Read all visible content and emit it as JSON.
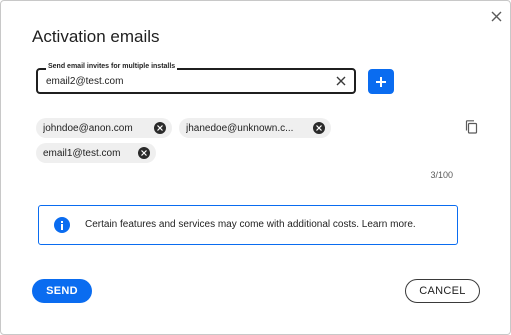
{
  "dialog": {
    "title": "Activation emails",
    "close_icon": "close-icon"
  },
  "email_field": {
    "label": "Send email invites for multiple installs",
    "value": "email2@test.com",
    "placeholder": "",
    "clear_icon": "clear-x-icon"
  },
  "add_button": {
    "icon": "plus-icon"
  },
  "chips": [
    {
      "label": "johndoe@anon.com"
    },
    {
      "label": "jhanedoe@unknown.c..."
    },
    {
      "label": "email1@test.com"
    }
  ],
  "copy_button": {
    "icon": "copy-icon"
  },
  "counter": "3/100",
  "info": {
    "icon": "info-icon",
    "text": "Certain features and services may come with additional costs.",
    "link": "Learn more."
  },
  "actions": {
    "send_label": "SEND",
    "cancel_label": "CANCEL"
  },
  "colors": {
    "accent": "#0a6cf0",
    "chip_bg": "#efefef",
    "text": "#1f1f1f"
  }
}
